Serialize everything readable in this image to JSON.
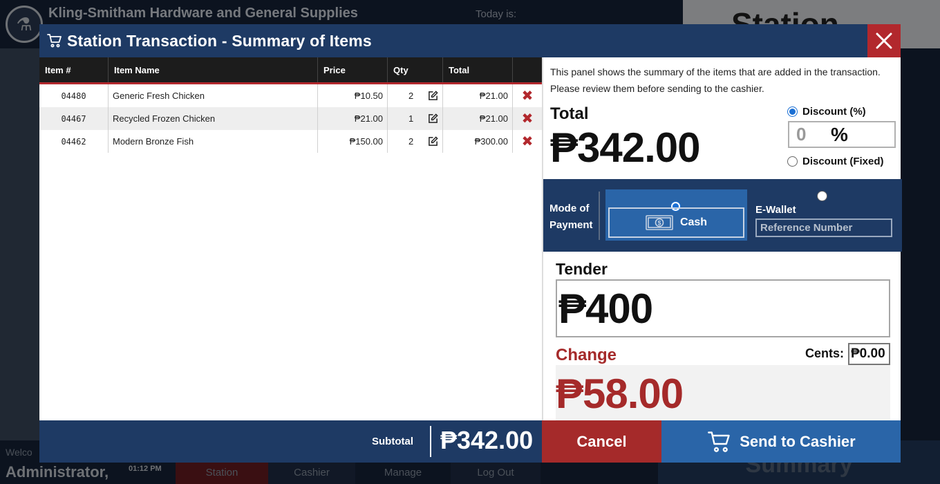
{
  "background": {
    "store_name": "Kling-Smitham Hardware and General Supplies",
    "today_label": "Today is:",
    "station_label": "Station",
    "welcome": "Welco",
    "user": "Administrator,",
    "time": "01:12 PM",
    "nav": {
      "station": "Station",
      "cashier": "Cashier",
      "manage": "Manage",
      "logout": "Log Out"
    },
    "summary": "Summary"
  },
  "modal": {
    "title": "Station Transaction - Summary of Items",
    "close_icon": "close-icon"
  },
  "table": {
    "headers": {
      "item_num": "Item #",
      "item_name": "Item Name",
      "price": "Price",
      "qty": "Qty",
      "total": "Total"
    },
    "rows": [
      {
        "num": "04480",
        "name": "Generic Fresh Chicken",
        "price": "₱10.50",
        "qty": "2",
        "total": "₱21.00"
      },
      {
        "num": "04467",
        "name": "Recycled Frozen Chicken",
        "price": "₱21.00",
        "qty": "1",
        "total": "₱21.00"
      },
      {
        "num": "04462",
        "name": "Modern Bronze Fish",
        "price": "₱150.00",
        "qty": "2",
        "total": "₱300.00"
      }
    ],
    "delete_glyph": "✖"
  },
  "footer": {
    "subtotal_label": "Subtotal",
    "subtotal_value": "₱342.00"
  },
  "panel": {
    "info": "This panel shows the summary of the items that are added in the transaction. Please review them before sending to the cashier.",
    "total_label": "Total",
    "total_value": "₱342.00",
    "discount_pct_label": "Discount (%)",
    "discount_value": "0",
    "discount_symbol": "%",
    "discount_fixed_label": "Discount (Fixed)",
    "mode_of_payment": "Mode of Payment",
    "cash_label": "Cash",
    "ewallet_label": "E-Wallet",
    "reference_placeholder": "Reference Number",
    "tender_label": "Tender",
    "tender_value": "₱400",
    "change_label": "Change",
    "cents_label": "Cents:",
    "cents_value": "₱0.00",
    "change_value": "₱58.00"
  },
  "actions": {
    "cancel": "Cancel",
    "send": "Send to Cashier"
  },
  "colors": {
    "navy": "#1e3a64",
    "accent_red": "#b2282d",
    "change_red": "#a52a2a",
    "blue": "#2a65a8"
  }
}
